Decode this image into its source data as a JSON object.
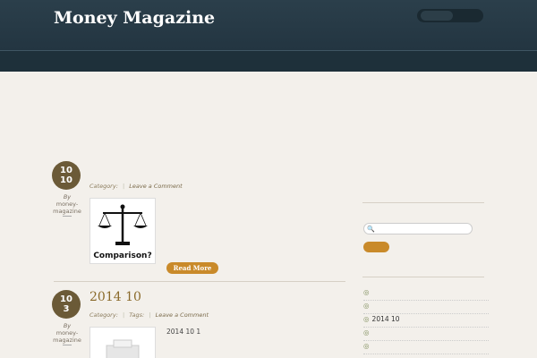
{
  "header": {
    "site_title": "Money Magazine",
    "site_description": "",
    "top_links": [
      "",
      ""
    ]
  },
  "nav": {
    "items": [
      "",
      "",
      "",
      "",
      ""
    ]
  },
  "intro": {
    "lines": [
      "",
      "",
      ""
    ]
  },
  "posts": [
    {
      "date_top": "10",
      "date_bottom": "10",
      "author_by": "By",
      "author": "money-magazine",
      "title": "",
      "meta_label": "Category:",
      "categories": [
        "",
        "",
        "",
        "",
        ""
      ],
      "comment_link": "Leave a Comment",
      "thumbnail_caption": "Comparison?",
      "excerpt_lines": [
        "",
        "",
        "",
        "",
        "",
        ""
      ],
      "read_more": "Read More"
    },
    {
      "date_top": "10",
      "date_bottom": "3",
      "author_by": "By",
      "author": "money-magazine",
      "title": "2014  10",
      "meta_label": "Category:",
      "categories": [
        ""
      ],
      "tags_label": "Tags:",
      "tags": [
        ""
      ],
      "comment_link": "Leave a Comment",
      "excerpt_lines": [
        "2014 10 1",
        "",
        ""
      ]
    }
  ],
  "sidebar": {
    "search_label": "",
    "search_placeholder": "",
    "search_button": "",
    "recent_posts": [
      "",
      "",
      "2014 10",
      "",
      ""
    ]
  }
}
